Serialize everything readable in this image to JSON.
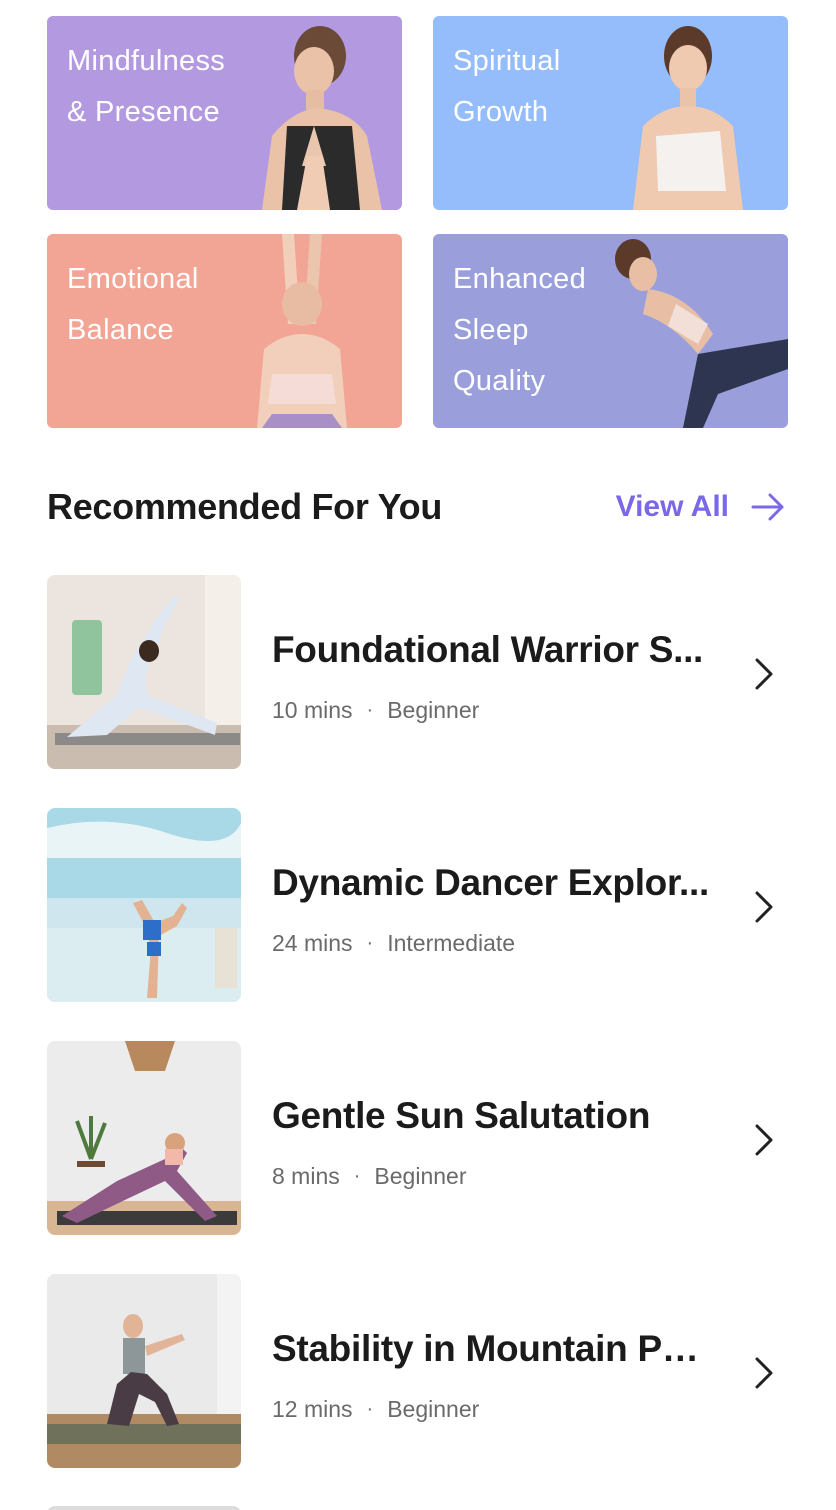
{
  "categories": [
    {
      "title": "Mindfulness\n& Presence",
      "color": "#b39ae0"
    },
    {
      "title": "Spiritual\nGrowth",
      "color": "#95bdfb"
    },
    {
      "title": "Emotional\nBalance",
      "color": "#f2a595"
    },
    {
      "title": "Enhanced\nSleep\nQuality",
      "color": "#9a9fdc"
    }
  ],
  "recommended": {
    "title": "Recommended For You",
    "view_all_label": "View All",
    "accent": "#7a68e8"
  },
  "sessions": [
    {
      "title": "Foundational Warrior S...",
      "duration": "10 mins",
      "level": "Beginner",
      "icon": "chevron-right-icon"
    },
    {
      "title": "Dynamic Dancer Explor...",
      "duration": "24 mins",
      "level": "Intermediate",
      "icon": "chevron-right-icon"
    },
    {
      "title": "Gentle Sun Salutation",
      "duration": "8 mins",
      "level": "Beginner",
      "icon": "chevron-right-icon"
    },
    {
      "title": "Stability in Mountain Po...",
      "duration": "12 mins",
      "level": "Beginner",
      "icon": "chevron-right-icon"
    }
  ],
  "separator": "·"
}
